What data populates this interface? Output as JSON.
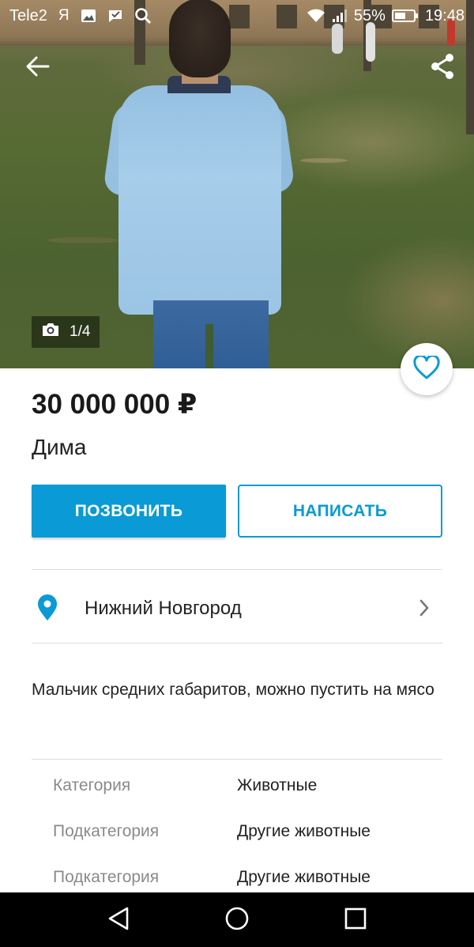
{
  "status_bar": {
    "carrier": "Tele2",
    "yandex_glyph": "Я",
    "battery_percent": "55%",
    "time": "19:48",
    "icons": [
      "gallery-icon",
      "messenger-icon",
      "search-icon",
      "wifi-icon",
      "signal-icon",
      "battery-icon"
    ]
  },
  "listing": {
    "photo_counter": "1/4",
    "price": "30 000 000 ₽",
    "title": "Дима",
    "call_label": "ПОЗВОНИТЬ",
    "write_label": "НАПИСАТЬ",
    "location": "Нижний Новгород",
    "description": "Мальчик средних габаритов, можно пустить на мясо",
    "params": [
      {
        "label": "Категория",
        "value": "Животные"
      },
      {
        "label": "Подкатегория",
        "value": "Другие животные"
      },
      {
        "label": "Подкатегория",
        "value": "Другие животные"
      }
    ]
  },
  "colors": {
    "accent": "#0a9ad6",
    "text": "#222222",
    "muted": "#8a8a8a",
    "divider": "#dedede"
  }
}
